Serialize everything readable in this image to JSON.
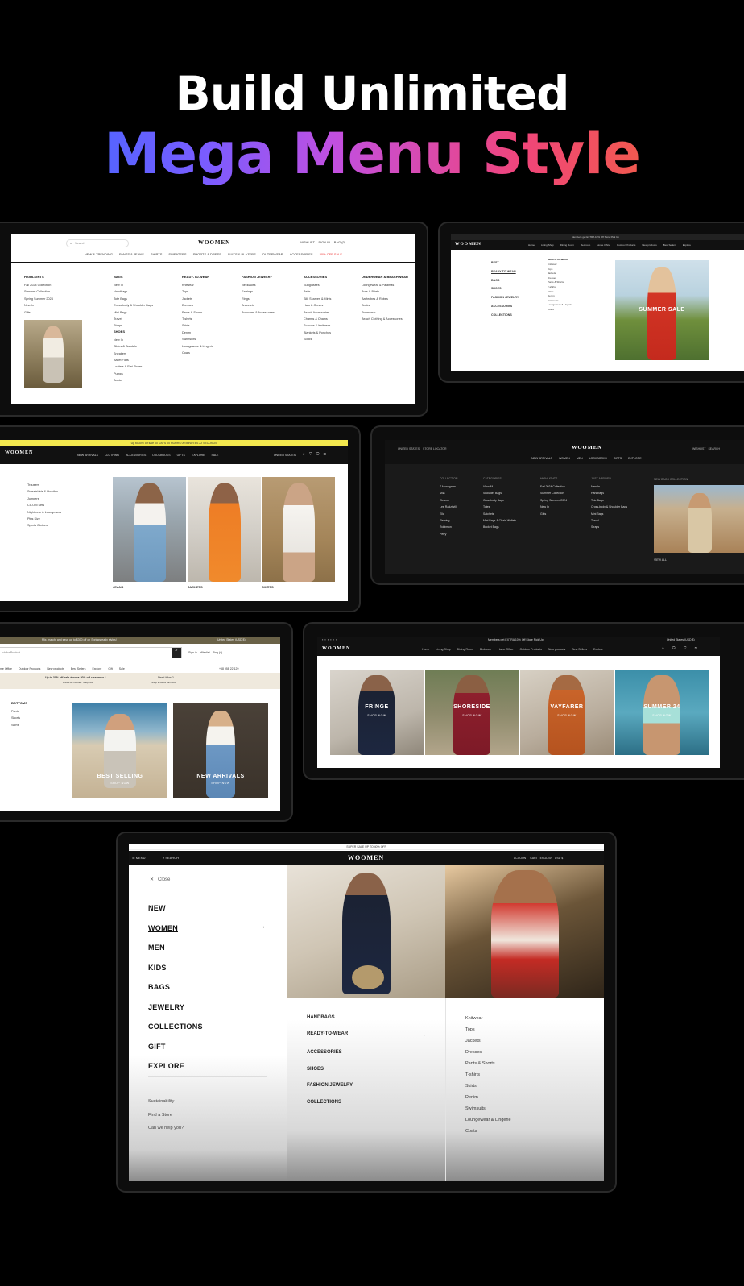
{
  "hero": {
    "line1": "Build Unlimited",
    "word1": "Mega",
    "word2": "Menu",
    "word3": "Style"
  },
  "brand": "WOOMEN",
  "s1": {
    "search": "Search",
    "actions": [
      "WISHLIST",
      "SIGN IN",
      "BAG (0)"
    ],
    "nav": [
      "NEW & TRENDING",
      "PANTS & JEANS",
      "SHIRTS",
      "SWEATERS",
      "SHORTS & DRESS",
      "SUITS & BLAZERS",
      "OUTERWEAR",
      "ACCESSORIES",
      "30% OFF SALE"
    ],
    "cols": [
      {
        "h": "HIGHLIGHTS",
        "items": [
          "Fall 2024 Collection",
          "Summer Collection",
          "Spring Summer 2024",
          "New In",
          "Gifts"
        ]
      },
      {
        "h": "BAGS",
        "items": [
          "New In",
          "Handbags",
          "Tote Bags",
          "Cross-body & Shoulder Bags",
          "Mini Bags",
          "Travel",
          "Straps",
          "",
          "SHOES",
          "New In",
          "Slides & Sandals",
          "Sneakers",
          "Ballet Flats",
          "Loafers & Flat Shoes",
          "Pumps",
          "Boots"
        ]
      },
      {
        "h": "READY-TO-WEAR",
        "items": [
          "Knitwear",
          "Tops",
          "Jackets",
          "Dresses",
          "Pants & Shorts",
          "T-shirts",
          "Skirts",
          "Denim",
          "Swimsuits",
          "Loungewear & Lingerie",
          "Coats"
        ]
      },
      {
        "h": "FASHION JEWELRY",
        "items": [
          "Necklaces",
          "Earrings",
          "Rings",
          "Bracelets",
          "Brooches & Accessories"
        ]
      },
      {
        "h": "ACCESSORIES",
        "items": [
          "Sunglasses",
          "Belts",
          "Silk Scarves & Minis",
          "Hats & Gloves",
          "Beach Accessories",
          "Charms & Chains",
          "Scarves & Knitwear",
          "Blankets & Ponchos",
          "Socks"
        ]
      },
      {
        "h": "UNDERWEAR & BEACHWEAR",
        "items": [
          "Loungewear & Pajamas",
          "Bras & Briefs",
          "Bathrobes & Robes",
          "Socks",
          "Swimwear",
          "Beach Clothing & Accessories"
        ]
      }
    ]
  },
  "s2": {
    "topbar": "Members get EXTRA 10% Off Store Pick Up",
    "nav": [
      "Home",
      "Living Shop",
      "Dining Room",
      "Bedroom",
      "Home Office",
      "Outdoor Products",
      "New products",
      "Best Sellers",
      "Explore"
    ],
    "menu": [
      "BEST",
      "READY-TO-WEAR",
      "BAGS",
      "SHOES",
      "FASHION JEWELRY",
      "ACCESSORIES",
      "COLLECTIONS"
    ],
    "sub": [
      "Knitwear",
      "Tops",
      "Jackets",
      "Dresses",
      "Pants & Shorts",
      "T-shirts",
      "Skirts",
      "Denim",
      "Swimsuits",
      "Loungewear & Lingerie",
      "Coats"
    ],
    "sub_head": "READY-TO-WEAR",
    "banner": "SUMMER SALE"
  },
  "s3": {
    "promo": "Up to 30% off sale   00 DAYS   00 HOURS   00 MINUTES   22 SECONDS",
    "nav": [
      "NEW ARRIVALS",
      "CLOTHING",
      "ACCESSORIES",
      "LOOKBOOKS",
      "GIFTS",
      "EXPLORE",
      "SALE"
    ],
    "right": "UNITED STATES",
    "list": [
      "Trousers",
      "Sweatshirts & Hoodies",
      "Jumpers",
      "Co-Ord Sets",
      "Nightwear & Loungewear",
      "Plus Size",
      "Sports Clothes"
    ],
    "caps": [
      "JEANS",
      "JACKETS",
      "SKIRTS"
    ]
  },
  "s4": {
    "left": [
      "UNITED STATES",
      "STORE LOCATOR"
    ],
    "right": [
      "WISHLIST",
      "SEARCH"
    ],
    "nav": [
      "NEW ARRIVALS",
      "WOMEN",
      "MEN",
      "LOOKBOOKS",
      "GIFTS",
      "EXPLORE"
    ],
    "cols": [
      {
        "h": "COLLECTION",
        "items": [
          "T Monogram",
          "Mila",
          "Eleanor",
          "Lee Radziwill",
          "Ella",
          "Fleming",
          "Robinson",
          "Perry"
        ]
      },
      {
        "h": "CATEGORIES",
        "items": [
          "View All",
          "Shoulder Bags",
          "Crossbody Bags",
          "Totes",
          "Satchels",
          "Mini Bags & Chain Wallets",
          "Bucket Bags"
        ]
      },
      {
        "h": "HIGHLIGHTS",
        "items": [
          "Fall 2024 Collection",
          "Summer Collection",
          "Spring Summer 2024",
          "New In",
          "Gifts"
        ]
      },
      {
        "h": "JUST ARRIVED",
        "items": [
          "New In",
          "Handbags",
          "Tote Bags",
          "Cross-body & Shoulder Bags",
          "Mini Bags",
          "Travel",
          "Straps"
        ]
      }
    ],
    "feature_h": "NEW BAGS COLLECTION",
    "view_all": "VIEW ALL"
  },
  "s5": {
    "promo": "Mix, match, and save up to $300 off on Springsready styles!",
    "region": "United States (USD $)",
    "search_ph": "rch for Product",
    "acts": [
      "Sign in",
      "Wishlist",
      "Bag (4)"
    ],
    "nav": [
      "me Office",
      "Outdoor Products",
      "New products",
      "Best Sellers",
      "Explore",
      "Gift",
      "Sale"
    ],
    "phone": "+58 958 22 129",
    "deal": "Up to 30% off sale + extra 20% off clearance.*",
    "deal_sub": "Prices as marked. Shop now",
    "help": "Need it fast?",
    "help_sub": "Shop in-stock furniture",
    "side_h": "BOTTOMS",
    "side": [
      "Pants",
      "Shorts",
      "Skirts"
    ],
    "caps": [
      "BEST SELLING",
      "NEW ARRIVALS"
    ],
    "shop": "SHOP NOW"
  },
  "s6": {
    "topbar": "Members get EXTRA 10% Off Store Pick Up",
    "region": "United States (USD $)",
    "nav": [
      "Home",
      "Living Shop",
      "Dining Room",
      "Bedroom",
      "Home Office",
      "Outdoor Products",
      "New products",
      "Best Sellers",
      "Explore"
    ],
    "caps": [
      "FRINGE",
      "SHORESIDE",
      "VAYFARER",
      "SUMMER 24"
    ],
    "shop": "SHOP NOW"
  },
  "s7": {
    "promo": "SUPER SALE UP TO 40% OFF",
    "menu": "MENU",
    "search": "SEARCH",
    "right": [
      "ACCOUNT",
      "CART",
      "ENGLISH",
      "USD $"
    ],
    "close": "Close",
    "main": [
      "NEW",
      "WOMEN",
      "MEN",
      "KIDS",
      "BAGS",
      "JEWELRY",
      "COLLECTIONS",
      "GIFT",
      "EXPLORE"
    ],
    "footer": [
      "Sustainability",
      "Find a Store",
      "Can we help you?"
    ],
    "sub1": [
      "HANDBAGS",
      "READY-TO-WEAR",
      "ACCESSORIES",
      "SHOES",
      "FASHION JEWELRY",
      "COLLECTIONS"
    ],
    "sub2": [
      "Knitwear",
      "Tops",
      "Jackets",
      "Dresses",
      "Pants & Shorts",
      "T-shirts",
      "Skirts",
      "Denim",
      "Swimsuits",
      "Loungewear & Lingerie",
      "Coats"
    ]
  }
}
